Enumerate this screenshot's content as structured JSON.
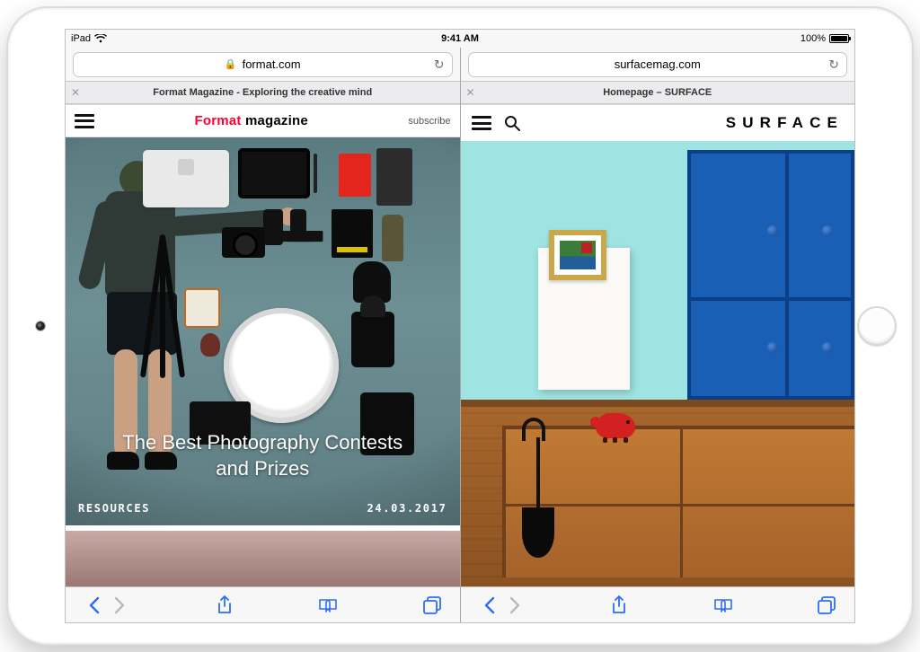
{
  "status": {
    "carrier": "iPad",
    "time": "9:41 AM",
    "battery_pct": "100%"
  },
  "panes": [
    {
      "url_host": "format.com",
      "secure": true,
      "tab_title": "Format Magazine - Exploring the creative mind",
      "site": {
        "brand_accent": "Format",
        "brand_rest": "magazine",
        "subscribe": "subscribe",
        "hero_title": "The Best Photography Contests and Prizes",
        "hero_category": "RESOURCES",
        "hero_date": "24.03.2017"
      }
    },
    {
      "url_host": "surfacemag.com",
      "secure": false,
      "tab_title": "Homepage – SURFACE",
      "site": {
        "brand": "SURFACE"
      }
    }
  ],
  "colors": {
    "ios_blue": "#2d6df6",
    "format_red": "#ff0033",
    "surface_cabinet": "#1a5fb6"
  }
}
